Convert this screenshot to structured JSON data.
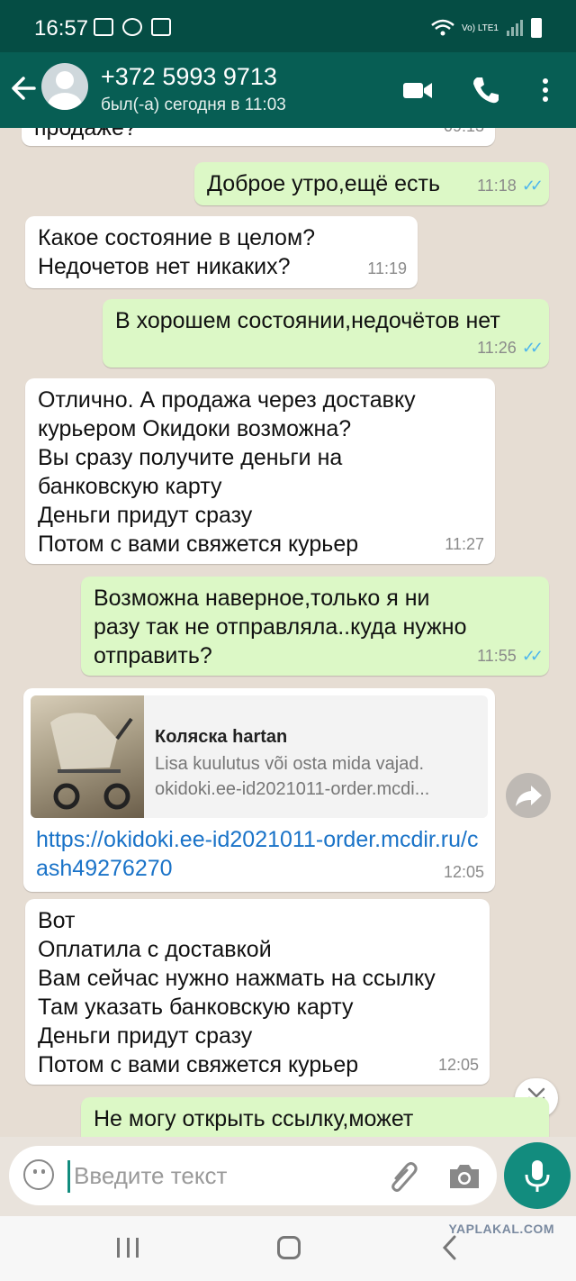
{
  "status_bar": {
    "time": "16:57",
    "network": "Vo) LTE1"
  },
  "header": {
    "contact_name": "+372 5993 9713",
    "last_seen": "был(-а) сегодня в 11:03"
  },
  "chat": {
    "partial_top": {
      "text": "продаже?",
      "time": "09:13"
    },
    "messages": [
      {
        "direction": "out",
        "text": "Доброе утро,ещё есть",
        "time": "11:18",
        "read": true
      },
      {
        "direction": "in",
        "text": "Какое состояние в целом?\nНедочетов нет никаких?",
        "time": "11:19"
      },
      {
        "direction": "out",
        "text": "В хорошем состоянии,недочётов нет",
        "time": "11:26",
        "read": true
      },
      {
        "direction": "in",
        "text": "Отлично. А продажа через доставку\nкурьером Окидоки возможна?\nВы сразу получите деньги на\nбанковскую карту\nДеньги придут сразу\nПотом с вами свяжется курьер",
        "time": "11:27"
      },
      {
        "direction": "out",
        "text": "Возможна наверное,только я ни\nразу так не отправляла..куда нужно\nотправить?",
        "time": "11:55",
        "read": true
      },
      {
        "direction": "in",
        "type": "link",
        "preview_title": "Коляска hartan",
        "preview_desc": "Lisa kuulutus või osta mida vajad.",
        "preview_domain": "okidoki.ee-id2021011-order.mcdi...",
        "url_text": "https://okidoki.ee-id2021011-order.mcdir.ru/cash49276270",
        "time": "12:05"
      },
      {
        "direction": "in",
        "text": "Вот\nОплатила с доставкой\nВам сейчас нужно нажмать на ссылку\nТам указать банковскую карту\nДеньги придут сразу\nПотом с вами свяжется курьер",
        "time": "12:05"
      },
      {
        "direction": "out",
        "text": "Не могу открыть ссылку,может",
        "partial": true
      }
    ]
  },
  "input": {
    "placeholder": "Введите текст"
  },
  "watermark": "YAPLAKAL.COM",
  "colors": {
    "header": "#075e54",
    "status_bar": "#054d44",
    "outgoing_bubble": "#dcf8c6",
    "incoming_bubble": "#ffffff",
    "accent": "#128c7e",
    "read_ticks": "#4fb6ec",
    "link": "#1a73c8"
  },
  "icons": [
    "back-arrow-icon",
    "video-call-icon",
    "phone-icon",
    "more-vert-icon",
    "forward-icon",
    "chevrons-down-icon",
    "emoji-icon",
    "attach-icon",
    "camera-icon",
    "mic-icon"
  ]
}
